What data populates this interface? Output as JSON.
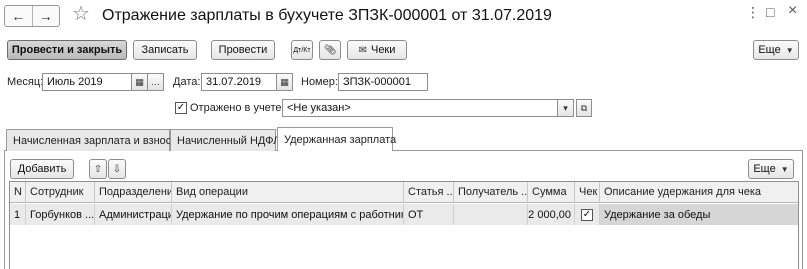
{
  "window": {
    "title": "Отражение зарплаты в бухучете ЗПЗК-000001 от 31.07.2019",
    "controls": [
      "⋮",
      "□",
      "×"
    ]
  },
  "nav": {
    "back": "←",
    "forward": "→"
  },
  "toolbar": {
    "post_and_close": "Провести и закрыть",
    "save": "Записать",
    "post": "Провести",
    "dtkt": "Дт/Кт",
    "checks": "Чеки",
    "more": "Еще"
  },
  "fields": {
    "month_label": "Месяц:",
    "month_value": "Июль 2019",
    "date_label": "Дата:",
    "date_value": "31.07.2019",
    "number_label": "Номер:",
    "number_value": "ЗПЗК-000001",
    "reflected_label": "Отражено в учете:",
    "reflected_checked": true,
    "reflected_value": "<Не указан>"
  },
  "tabs": [
    "Начисленная зарплата и взносы",
    "Начисленный НДФЛ",
    "Удержанная зарплата"
  ],
  "active_tab": 2,
  "table_toolbar": {
    "add": "Добавить",
    "more": "Еще"
  },
  "table": {
    "columns": [
      "N",
      "Сотрудник",
      "Подразделение",
      "Вид операции",
      "Статья ...",
      "Получатель ...",
      "Сумма",
      "Чек",
      "Описание удержания для чека"
    ],
    "rows": [
      [
        "1",
        "Горбунков ...",
        "Администрация",
        "Удержание по прочим операциям с работниками",
        "ОТ",
        "",
        "2 000,00",
        "✓",
        "Удержание за обеды"
      ]
    ]
  }
}
